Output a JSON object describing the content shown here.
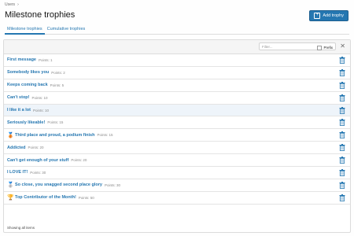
{
  "breadcrumb": {
    "item": "Users",
    "separator": "›"
  },
  "page": {
    "title": "Milestone trophies"
  },
  "actions": {
    "add_label": "Add trophy"
  },
  "tabs": [
    {
      "label": "Milestone trophies",
      "active": true
    },
    {
      "label": "Cumulative trophies",
      "active": false
    }
  ],
  "filter": {
    "placeholder": "Filter...",
    "prefix_label": "Prefix",
    "close": "✕"
  },
  "trophies": [
    {
      "name": "First message",
      "points": "Points: 1",
      "icon": ""
    },
    {
      "name": "Somebody likes you",
      "points": "Points: 2",
      "icon": ""
    },
    {
      "name": "Keeps coming back",
      "points": "Points: 5",
      "icon": ""
    },
    {
      "name": "Can't stop!",
      "points": "Points: 10",
      "icon": ""
    },
    {
      "name": "I like it a lot",
      "points": "Points: 10",
      "icon": ""
    },
    {
      "name": "Seriously likeable!",
      "points": "Points: 15",
      "icon": ""
    },
    {
      "name": "Third place and proud, a podium finish",
      "points": "Points: 15",
      "icon": "bronze-medal-icon"
    },
    {
      "name": "Addicted",
      "points": "Points: 20",
      "icon": ""
    },
    {
      "name": "Can't get enough of your stuff",
      "points": "Points: 20",
      "icon": ""
    },
    {
      "name": "I LOVE IT!",
      "points": "Points: 30",
      "icon": ""
    },
    {
      "name": "So close, you snagged second place glory",
      "points": "Points: 30",
      "icon": "silver-medal-icon"
    },
    {
      "name": "Top Contributor of the Month!",
      "points": "Points: 50",
      "icon": "gold-trophy-icon"
    }
  ],
  "footer": {
    "text": "Showing all items"
  },
  "colors": {
    "accent": "#2577b1",
    "toolbar": "#f5f5f5",
    "border": "#dcdcdc",
    "highlight": "#eef4fa"
  }
}
